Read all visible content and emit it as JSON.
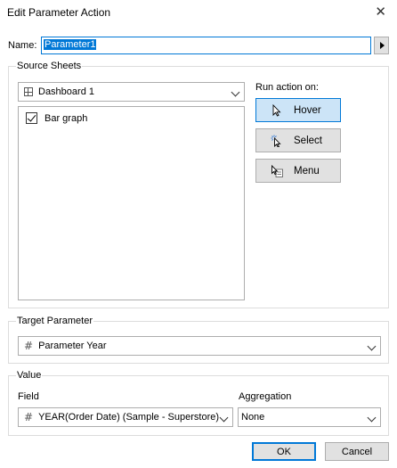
{
  "window": {
    "title": "Edit Parameter Action",
    "close_glyph": "✕"
  },
  "name": {
    "label": "Name:",
    "value": "Parameter1"
  },
  "source_sheets": {
    "group_label": "Source Sheets",
    "dashboard": {
      "value": "Dashboard 1",
      "icon": "dashboard-grid-icon"
    },
    "sheets": [
      {
        "label": "Bar graph",
        "checked": true
      }
    ]
  },
  "run_action": {
    "label": "Run action on:",
    "options": [
      {
        "label": "Hover",
        "icon": "cursor-icon",
        "selected": true
      },
      {
        "label": "Select",
        "icon": "select-cursor-icon",
        "selected": false
      },
      {
        "label": "Menu",
        "icon": "menu-icon",
        "selected": false
      }
    ]
  },
  "target_parameter": {
    "group_label": "Target Parameter",
    "value": "Parameter Year",
    "icon": "hash-icon"
  },
  "value": {
    "group_label": "Value",
    "field": {
      "label": "Field",
      "value": "YEAR(Order Date) (Sample - Superstore)",
      "icon": "hash-icon"
    },
    "aggregation": {
      "label": "Aggregation",
      "value": "None"
    }
  },
  "buttons": {
    "ok": "OK",
    "cancel": "Cancel"
  },
  "colors": {
    "accent": "#0078d7",
    "selected_bg": "#cce4f7",
    "button_bg": "#e1e1e1"
  }
}
